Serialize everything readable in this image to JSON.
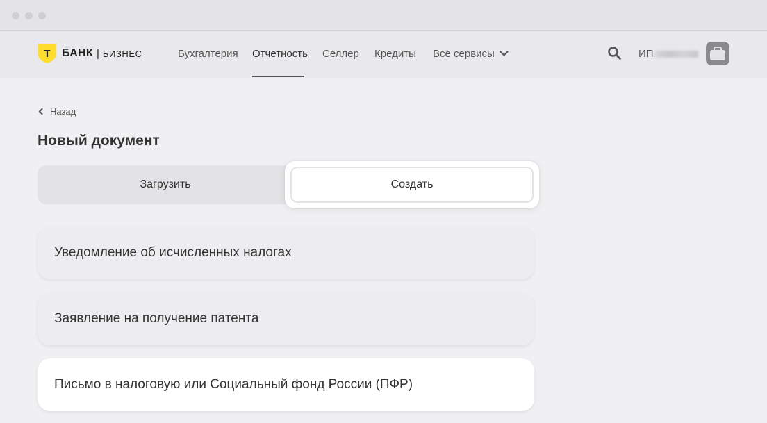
{
  "header": {
    "logo": {
      "bank": "БАНК",
      "separator": "|",
      "business": "БИЗНЕС",
      "mark": "Т"
    },
    "nav": [
      "Бухгалтерия",
      "Отчетность",
      "Селлер",
      "Кредиты",
      "Все сервисы"
    ],
    "active_nav": "Отчетность",
    "user_prefix": "ИП"
  },
  "back_label": "Назад",
  "page_title": "Новый документ",
  "segmented": {
    "upload": "Загрузить",
    "create": "Создать",
    "selected": "Создать"
  },
  "documents": [
    "Уведомление об исчисленных налогах",
    "Заявление на получение патента",
    "Письмо в налоговую или Социальный фонд России (ПФР)"
  ],
  "colors": {
    "brand_yellow": "#ffdd2d",
    "text": "#333333",
    "background": "#f0f0f2"
  },
  "icons": [
    "shield-logo-icon",
    "chevron-down-icon",
    "search-icon",
    "briefcase-icon",
    "chevron-left-icon"
  ]
}
